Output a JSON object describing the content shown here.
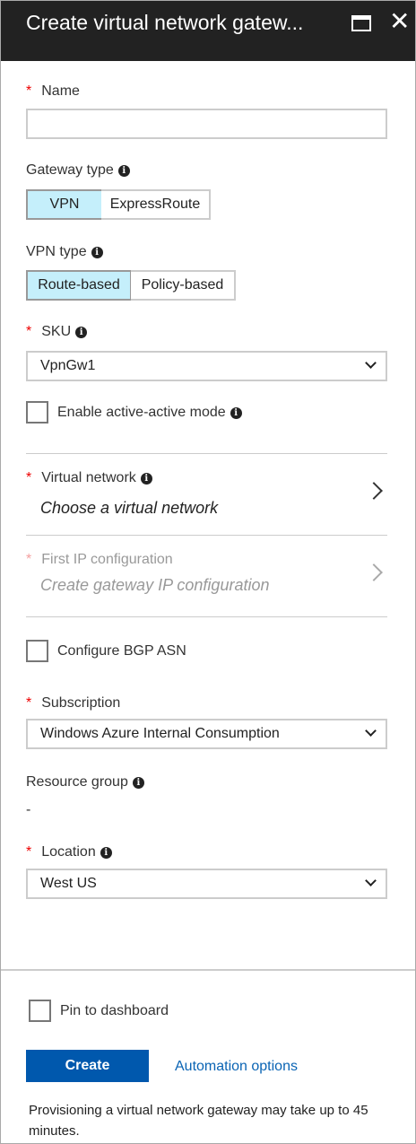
{
  "header": {
    "title": "Create virtual network gatew...",
    "maximize_icon": "maximize-icon",
    "close_icon": "close-icon"
  },
  "form": {
    "name": {
      "label": "Name",
      "value": ""
    },
    "gateway_type": {
      "label": "Gateway type",
      "options": [
        "VPN",
        "ExpressRoute"
      ],
      "selected": "VPN"
    },
    "vpn_type": {
      "label": "VPN type",
      "options": [
        "Route-based",
        "Policy-based"
      ],
      "selected": "Route-based"
    },
    "sku": {
      "label": "SKU",
      "value": "VpnGw1"
    },
    "active_active": {
      "label": "Enable active-active mode",
      "checked": false
    },
    "virtual_network": {
      "label": "Virtual network",
      "value": "Choose a virtual network"
    },
    "first_ip": {
      "label": "First IP configuration",
      "value": "Create gateway IP configuration"
    },
    "bgp": {
      "label": "Configure BGP ASN",
      "checked": false
    },
    "subscription": {
      "label": "Subscription",
      "value": "Windows Azure Internal Consumption"
    },
    "resource_group": {
      "label": "Resource group",
      "value": "-"
    },
    "location": {
      "label": "Location",
      "value": "West US"
    }
  },
  "footer": {
    "pin_label": "Pin to dashboard",
    "pin_checked": false,
    "create_label": "Create",
    "automation_label": "Automation options",
    "note": "Provisioning a virtual network gateway may take up to 45 minutes."
  },
  "colors": {
    "header_bg": "#222222",
    "primary": "#0058ad",
    "link": "#0a64b4",
    "selected_segment": "#c5effb",
    "required": "#e00000"
  }
}
